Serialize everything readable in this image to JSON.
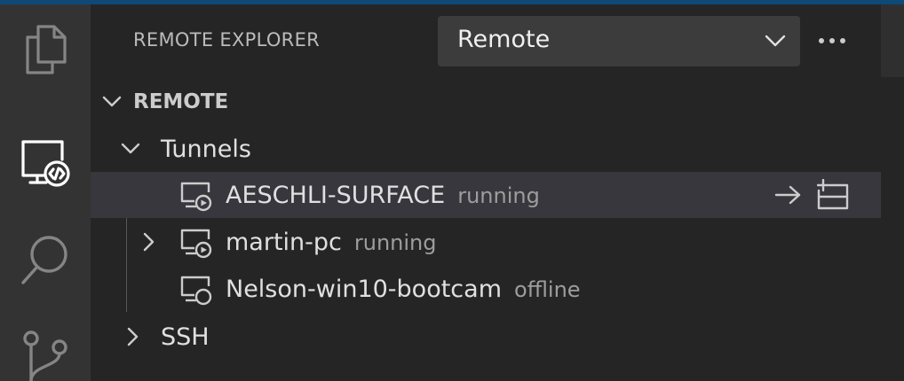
{
  "activity_bar": {
    "items": [
      {
        "name": "explorer",
        "icon": "files-icon",
        "active": false
      },
      {
        "name": "remote-explorer",
        "icon": "remote-explorer-icon",
        "active": true
      },
      {
        "name": "search",
        "icon": "search-icon",
        "active": false
      },
      {
        "name": "source-control",
        "icon": "source-control-icon",
        "active": false
      }
    ]
  },
  "sidebar": {
    "title": "REMOTE EXPLORER",
    "dropdown": {
      "selected": "Remote"
    },
    "section": {
      "label": "REMOTE",
      "expanded": true
    },
    "tree": {
      "tunnels": {
        "label": "Tunnels",
        "expanded": true,
        "items": [
          {
            "name": "AESCHLI-SURFACE",
            "status": "running",
            "selected": true,
            "expandable": false
          },
          {
            "name": "martin-pc",
            "status": "running",
            "selected": false,
            "expandable": true
          },
          {
            "name": "Nelson-win10-bootcam",
            "status": "offline",
            "selected": false,
            "expandable": false
          }
        ]
      },
      "ssh": {
        "label": "SSH",
        "expanded": false
      }
    },
    "row_actions": [
      "connect-arrow-icon",
      "new-window-icon"
    ]
  },
  "colors": {
    "activity_bar_bg": "#333333",
    "sidebar_bg": "#252526",
    "selected_row_bg": "#37373d",
    "dropdown_bg": "#3c3c3c",
    "accent_topline": "#0e4a77"
  }
}
